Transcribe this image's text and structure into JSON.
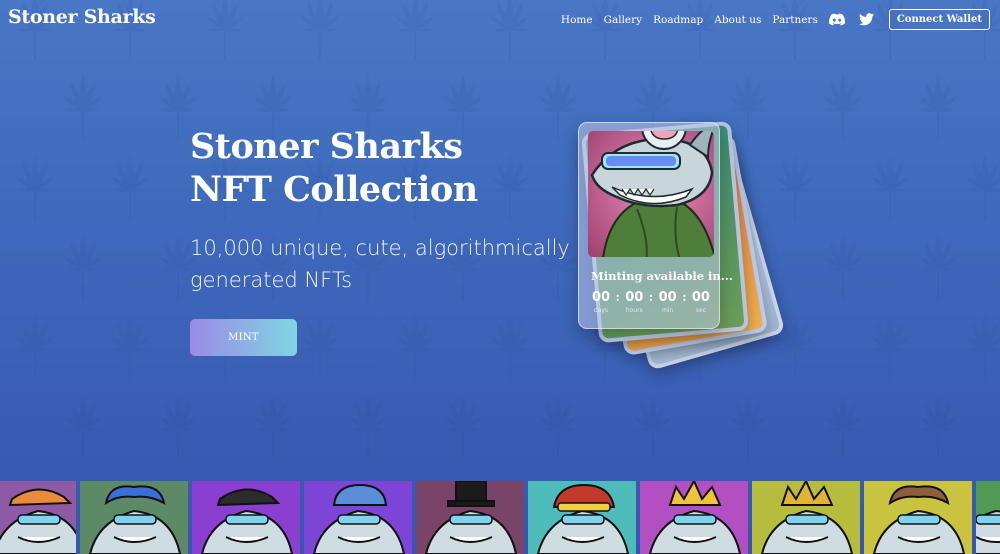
{
  "brand": "Stoner Sharks",
  "nav": {
    "links": [
      "Home",
      "Gallery",
      "Roadmap",
      "About us",
      "Partners"
    ],
    "icons": [
      "discord-icon",
      "twitter-icon"
    ],
    "connect_label": "Connect Wallet"
  },
  "hero": {
    "title_line1": "Stoner Sharks",
    "title_line2": "NFT Collection",
    "subtitle": "10,000 unique, cute, algorithmically generated NFTs",
    "mint_label": "MINT"
  },
  "card": {
    "status": "Minting available in...",
    "countdown": [
      {
        "value": "00",
        "label": "days"
      },
      {
        "value": "00",
        "label": "hours"
      },
      {
        "value": "00",
        "label": "min"
      },
      {
        "value": "00",
        "label": "sec"
      }
    ]
  },
  "gallery_strip": [
    {
      "bg": "#8e5aa6",
      "accent": "#e98a3c",
      "hat": "cap"
    },
    {
      "bg": "#5c8a66",
      "accent": "#3a6fd8",
      "hat": "hair"
    },
    {
      "bg": "#8a3fd0",
      "accent": "#2c2c2c",
      "hat": "cap"
    },
    {
      "bg": "#7d45d6",
      "accent": "#5a8ed6",
      "hat": "beanie"
    },
    {
      "bg": "#7a4468",
      "accent": "#1b1b1b",
      "hat": "tophat"
    },
    {
      "bg": "#4fbcbc",
      "accent": "#c0392b",
      "hat": "helmet"
    },
    {
      "bg": "#b24fc2",
      "accent": "#f0c43a",
      "hat": "spiky"
    },
    {
      "bg": "#b6bd3d",
      "accent": "#e2b334",
      "hat": "spiky"
    },
    {
      "bg": "#c9c340",
      "accent": "#8b5e3c",
      "hat": "hair"
    },
    {
      "bg": "#4f9b54",
      "accent": "#333333",
      "hat": "none"
    }
  ],
  "colors": {
    "bg_top": "#4a76c6",
    "bg_bottom": "#3656ad",
    "mint_gradient_start": "#9b8ae6",
    "mint_gradient_end": "#7fd6e2"
  }
}
